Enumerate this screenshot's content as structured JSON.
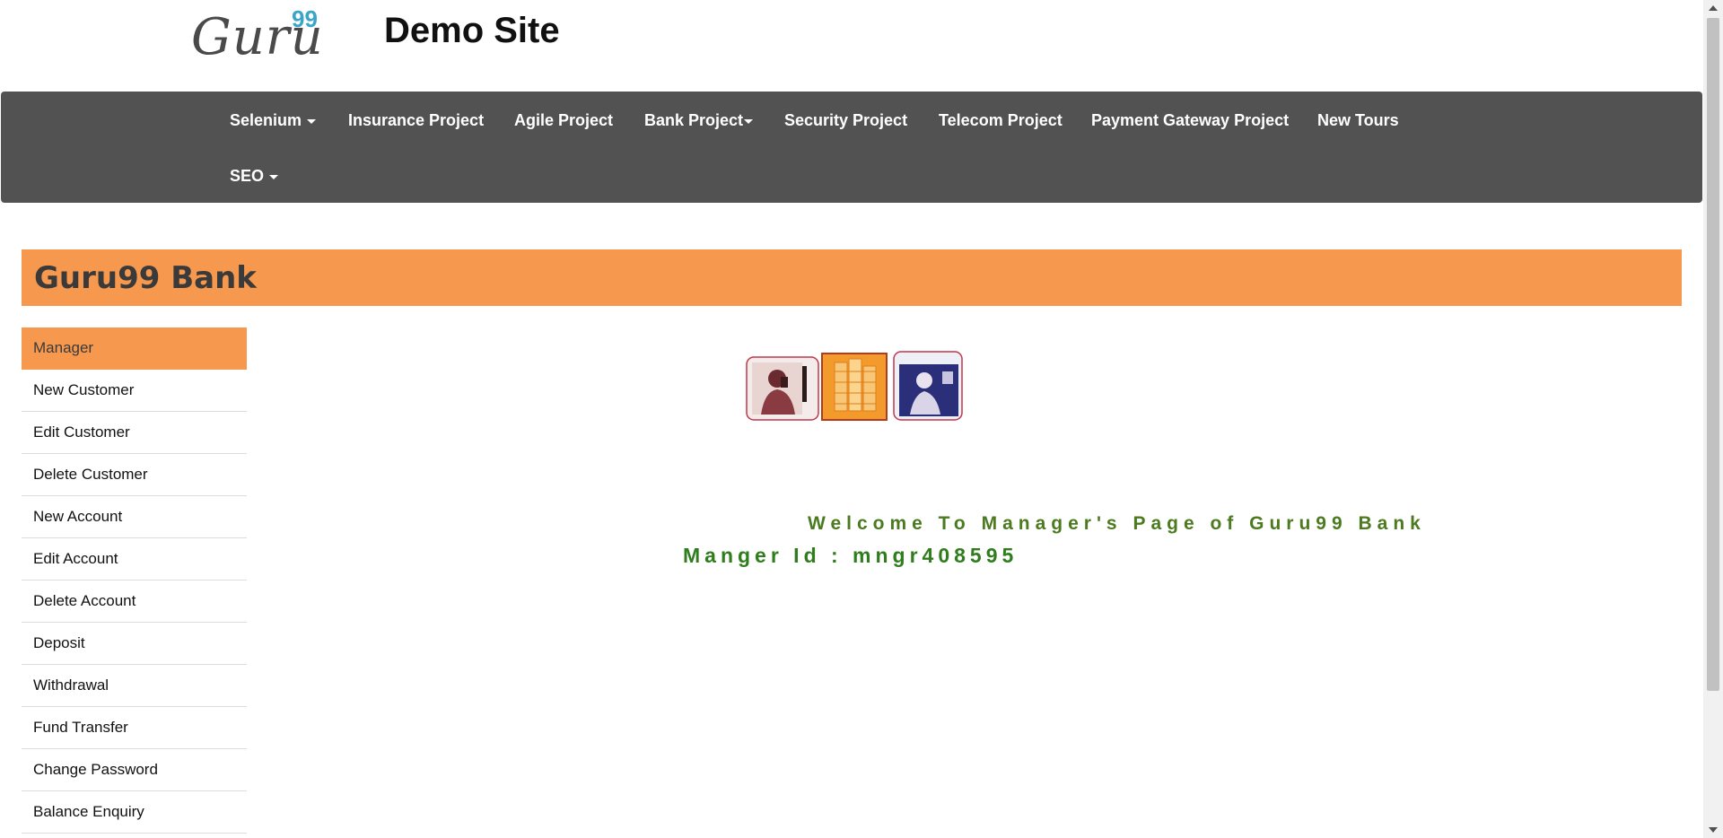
{
  "header": {
    "logo_text": "Guru",
    "logo_superscript": "99",
    "site_title": "Demo Site"
  },
  "navbar": {
    "items": [
      {
        "label": "Selenium",
        "dropdown": true
      },
      {
        "label": "Insurance Project",
        "dropdown": false
      },
      {
        "label": "Agile Project",
        "dropdown": false
      },
      {
        "label": "Bank Project",
        "dropdown": true
      },
      {
        "label": "Security Project",
        "dropdown": false
      },
      {
        "label": "Telecom Project",
        "dropdown": false
      },
      {
        "label": "Payment Gateway Project",
        "dropdown": false
      },
      {
        "label": "New Tours",
        "dropdown": false
      },
      {
        "label": "SEO",
        "dropdown": true
      }
    ]
  },
  "bank": {
    "title": "Guru99 Bank"
  },
  "sidebar": {
    "items": [
      {
        "label": "Manager",
        "active": true
      },
      {
        "label": "New Customer"
      },
      {
        "label": "Edit Customer"
      },
      {
        "label": "Delete Customer"
      },
      {
        "label": "New Account"
      },
      {
        "label": "Edit Account"
      },
      {
        "label": "Delete Account"
      },
      {
        "label": "Deposit"
      },
      {
        "label": "Withdrawal"
      },
      {
        "label": "Fund Transfer"
      },
      {
        "label": "Change Password"
      },
      {
        "label": "Balance Enquiry"
      }
    ]
  },
  "main": {
    "welcome": "Welcome To Manager's Page of Guru99 Bank",
    "manager_id": "Manger Id : mngr408595"
  },
  "colors": {
    "accent_orange": "#f7984f",
    "navbar_gray": "#525252",
    "welcome_green": "#4b7a1f",
    "logo_blue": "#3aa6c7"
  }
}
